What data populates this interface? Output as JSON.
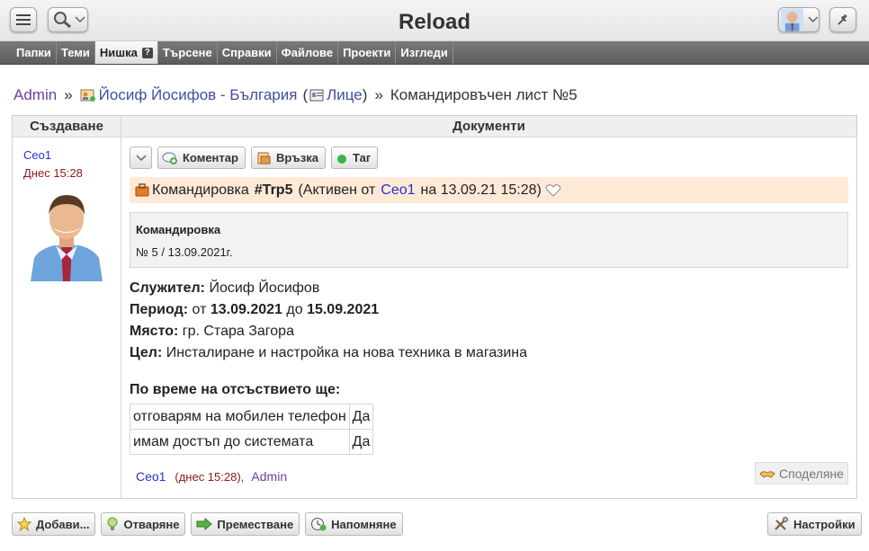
{
  "app": {
    "title": "Reload"
  },
  "nav": {
    "tabs": [
      "Папки",
      "Теми",
      "Нишка",
      "Търсене",
      "Справки",
      "Файлове",
      "Проекти",
      "Изгледи"
    ],
    "active_index": 2,
    "help_badge": "?"
  },
  "breadcrumb": {
    "admin": "Admin",
    "sep": "»",
    "contact": "Йосиф Йосифов - България",
    "paren_open": "(",
    "type": "Лице",
    "paren_close": ")",
    "document": "Командировъчен лист №5"
  },
  "columns": {
    "left": "Създаване",
    "right": "Документи"
  },
  "creator": {
    "name": "Ceo1",
    "date": "Днес 15:28"
  },
  "toolbar": {
    "comment": "Коментар",
    "link": "Връзка",
    "tag": "Таг"
  },
  "status": {
    "type": "Командировка",
    "handle": "#Trp5",
    "active_from": "(Активен от",
    "user": "Ceo1",
    "date_text": "на 13.09.21 15:28)"
  },
  "document": {
    "title": "Командировка",
    "number": "№ 5 / 13.09.2021г."
  },
  "fields": {
    "employee_label": "Служител:",
    "employee": "Йосиф Йосифов",
    "period_label": "Период:",
    "from_word": "от",
    "from_date": "13.09.2021",
    "to_word": "до",
    "to_date": "15.09.2021",
    "place_label": "Място:",
    "place": "гр. Стара Загора",
    "goal_label": "Цел:",
    "goal": "Инсталиране и настройка на нова техника в магазина"
  },
  "absence": {
    "heading": "По време на отсъствието ще:",
    "rows": [
      {
        "task": "отговарям на мобилен телефон",
        "value": "Да"
      },
      {
        "task": "имам достъп до системата",
        "value": "Да"
      }
    ]
  },
  "footer": {
    "user": "Ceo1",
    "date": "днес 15:28",
    "open": "(",
    "close": "),",
    "admin": "Admin",
    "share": "Споделяне"
  },
  "bottom": {
    "add": "Добави...",
    "unread": "Отваряне",
    "move": "Преместване",
    "remind": "Напомняне",
    "settings": "Настройки"
  },
  "colors": {
    "accent_link": "#2233cc",
    "status_bg": "#fde9d6",
    "nav_bg": "#5c5c5c"
  }
}
